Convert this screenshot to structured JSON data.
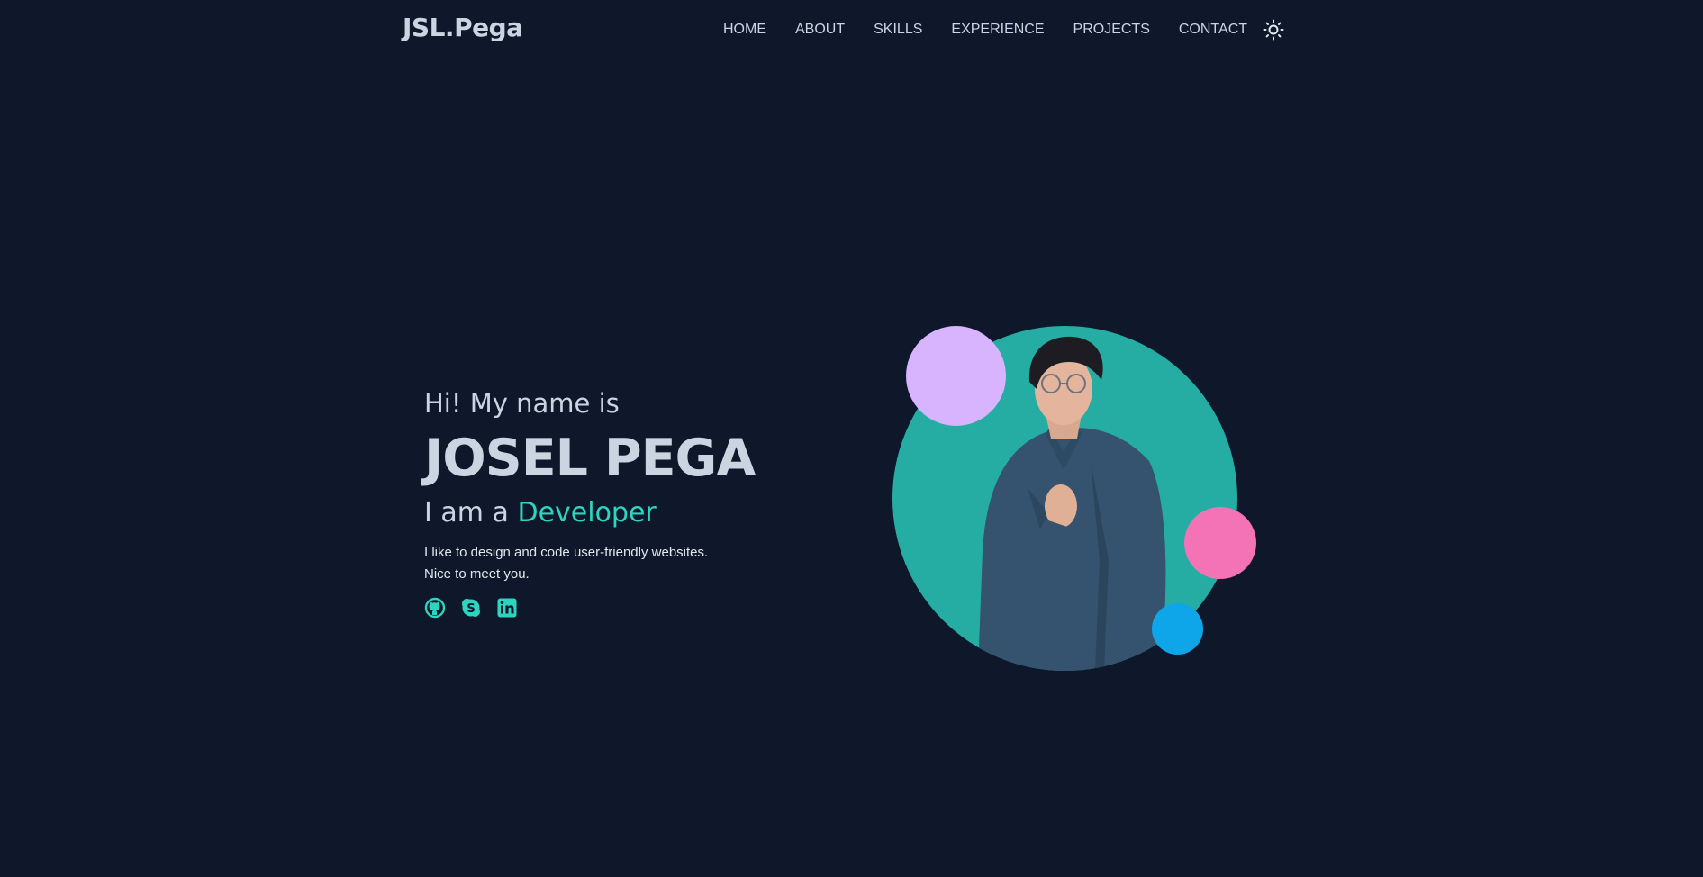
{
  "header": {
    "logo": "JSL.Pega",
    "nav": [
      "HOME",
      "ABOUT",
      "SKILLS",
      "EXPERIENCE",
      "PROJECTS",
      "CONTACT"
    ],
    "theme_toggle_icon": "sun-icon"
  },
  "hero": {
    "greeting": "Hi! My name is",
    "name": "JOSEL PEGA",
    "role_prefix": "I am a",
    "role_highlight": "Developer",
    "description_line1": "I like to design and code user-friendly websites.",
    "description_line2": "Nice to meet you.",
    "socials": [
      {
        "icon": "github-icon"
      },
      {
        "icon": "skype-icon"
      },
      {
        "icon": "linkedin-icon"
      }
    ],
    "portrait_alt": "portrait photo"
  },
  "colors": {
    "background": "#0f172a",
    "text": "#cbd5e1",
    "accent": "#2dd4bf",
    "portrait_circle": "#26ada3",
    "blob_violet": "#d8b4fe",
    "blob_pink": "#f472b6",
    "blob_blue": "#0ea5e9"
  }
}
